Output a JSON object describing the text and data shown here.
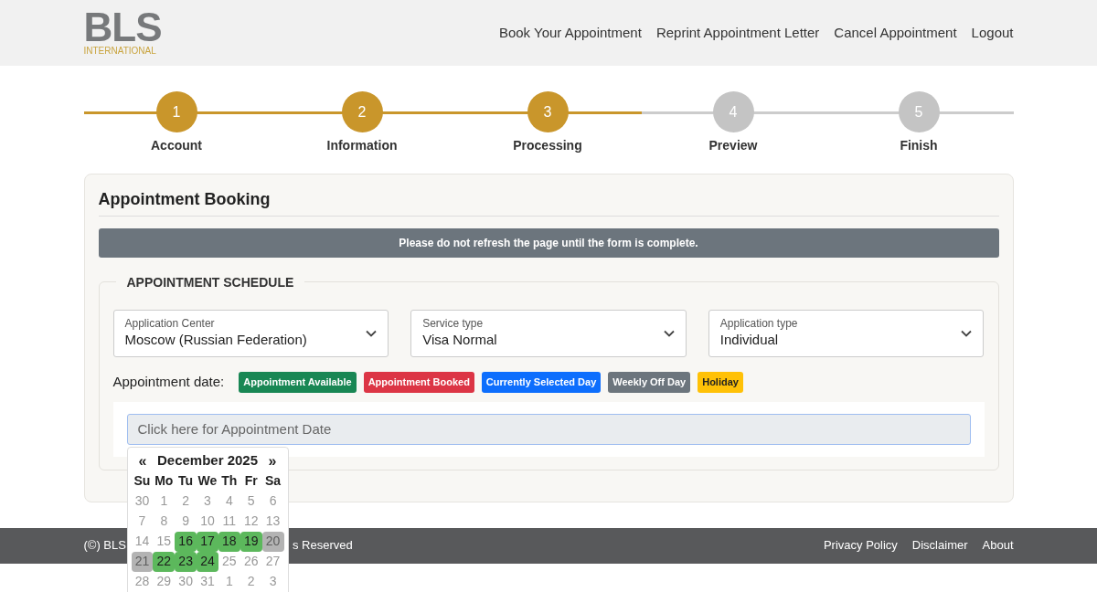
{
  "header": {
    "logo": {
      "mark": "BLS",
      "subtitle": "INTERNATIONAL"
    },
    "nav": [
      "Book Your Appointment",
      "Reprint Appointment Letter",
      "Cancel Appointment",
      "Logout"
    ]
  },
  "stepper": {
    "level": 0.6,
    "steps": [
      {
        "number": "1",
        "label": "Account",
        "done": true
      },
      {
        "number": "2",
        "label": "Information",
        "done": true
      },
      {
        "number": "3",
        "label": "Processing",
        "done": true
      },
      {
        "number": "4",
        "label": "Preview",
        "done": false
      },
      {
        "number": "5",
        "label": "Finish",
        "done": false
      }
    ]
  },
  "card": {
    "title": "Appointment Booking",
    "alert": "Please do not refresh the page until the form is complete.",
    "section": "APPOINTMENT SCHEDULE",
    "selects": [
      {
        "label": "Application Center",
        "value": "Moscow (Russian Federation)"
      },
      {
        "label": "Service type",
        "value": "Visa Normal"
      },
      {
        "label": "Application type",
        "value": "Individual"
      }
    ],
    "date_label": "Appointment date:",
    "legend": [
      {
        "label": "Appointment Available",
        "color": "#198754"
      },
      {
        "label": "Appointment Booked",
        "color": "#dc3545"
      },
      {
        "label": "Currently Selected Day",
        "color": "#0d6efd"
      },
      {
        "label": "Weekly Off Day",
        "color": "#6c757d"
      },
      {
        "label": "Holiday",
        "color": "#ffc107"
      }
    ],
    "date_field": {
      "placeholder": "Click here for Appointment Date"
    }
  },
  "calendar": {
    "prev": "«",
    "title": "December 2025",
    "next": "»",
    "weekdays": [
      "Su",
      "Mo",
      "Tu",
      "We",
      "Th",
      "Fr",
      "Sa"
    ],
    "weeks": [
      [
        {
          "day": "30",
          "kind": "disabled"
        },
        {
          "day": "1",
          "kind": "disabled"
        },
        {
          "day": "2",
          "kind": "disabled"
        },
        {
          "day": "3",
          "kind": "disabled"
        },
        {
          "day": "4",
          "kind": "disabled"
        },
        {
          "day": "5",
          "kind": "disabled"
        },
        {
          "day": "6",
          "kind": "disabled"
        }
      ],
      [
        {
          "day": "7",
          "kind": "disabled"
        },
        {
          "day": "8",
          "kind": "disabled"
        },
        {
          "day": "9",
          "kind": "disabled"
        },
        {
          "day": "10",
          "kind": "disabled"
        },
        {
          "day": "11",
          "kind": "disabled"
        },
        {
          "day": "12",
          "kind": "disabled"
        },
        {
          "day": "13",
          "kind": "disabled"
        }
      ],
      [
        {
          "day": "14",
          "kind": "disabled"
        },
        {
          "day": "15",
          "kind": "disabled"
        },
        {
          "day": "16",
          "kind": "available"
        },
        {
          "day": "17",
          "kind": "available"
        },
        {
          "day": "18",
          "kind": "available"
        },
        {
          "day": "19",
          "kind": "available"
        },
        {
          "day": "20",
          "kind": "off"
        }
      ],
      [
        {
          "day": "21",
          "kind": "off"
        },
        {
          "day": "22",
          "kind": "available"
        },
        {
          "day": "23",
          "kind": "available"
        },
        {
          "day": "24",
          "kind": "available"
        },
        {
          "day": "25",
          "kind": "disabled"
        },
        {
          "day": "26",
          "kind": "disabled"
        },
        {
          "day": "27",
          "kind": "disabled"
        }
      ],
      [
        {
          "day": "28",
          "kind": "disabled"
        },
        {
          "day": "29",
          "kind": "disabled"
        },
        {
          "day": "30",
          "kind": "disabled"
        },
        {
          "day": "31",
          "kind": "disabled"
        },
        {
          "day": "1",
          "kind": "disabled"
        },
        {
          "day": "2",
          "kind": "disabled"
        },
        {
          "day": "3",
          "kind": "disabled"
        }
      ]
    ]
  },
  "footer": {
    "copyright_start": "(©) BLS",
    "copyright_end": "s Reserved",
    "links": [
      "Privacy Policy",
      "Disclaimer",
      "About"
    ]
  }
}
